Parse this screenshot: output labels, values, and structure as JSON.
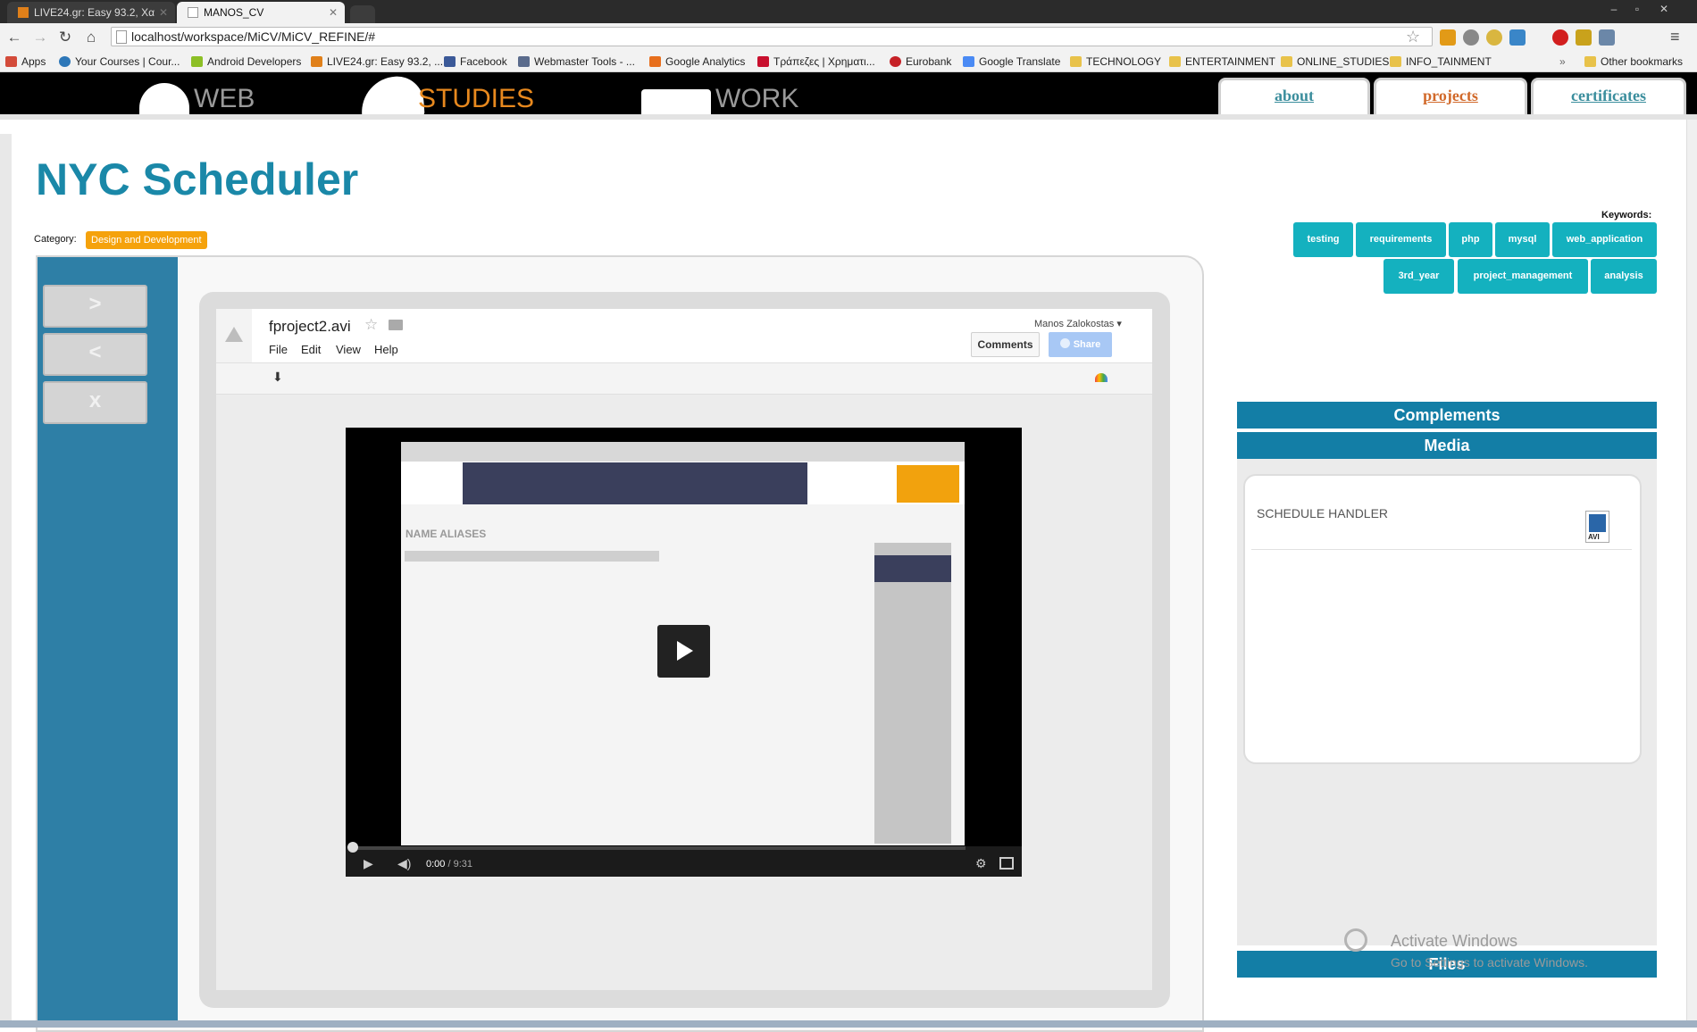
{
  "browser": {
    "tabs": [
      {
        "title": "LIVE24.gr: Easy 93.2, Χα",
        "active": false
      },
      {
        "title": "MANOS_CV",
        "active": true
      }
    ],
    "url": "localhost/workspace/MiCV/MiCV_REFINE/#",
    "bookmarks": [
      "Apps",
      "Your Courses | Cour...",
      "Android Developers",
      "LIVE24.gr: Easy 93.2, ...",
      "Facebook",
      "Webmaster Tools - ...",
      "Google Analytics",
      "Τράπεζες | Χρηματι...",
      "Eurobank",
      "Google Translate",
      "TECHNOLOGY",
      "ENTERTAINMENT",
      "ONLINE_STUDIES",
      "INFO_TAINMENT"
    ],
    "other_bookmarks": "Other bookmarks",
    "overflow": "»",
    "window_controls": [
      "–",
      "▫",
      "✕"
    ]
  },
  "site": {
    "nav": [
      {
        "label": "WEB",
        "active": false
      },
      {
        "label": "STUDIES",
        "active": true
      },
      {
        "label": "WORK",
        "active": false
      }
    ],
    "tabs": [
      {
        "label": "about",
        "active": false
      },
      {
        "label": "projects",
        "active": true
      },
      {
        "label": "certificates",
        "active": false
      }
    ]
  },
  "project": {
    "title": "NYC Scheduler",
    "category_label": "Category:",
    "category": "Design and Development",
    "side_buttons": [
      ">",
      "<",
      "x"
    ],
    "keywords_label": "Keywords:",
    "keywords": [
      "testing",
      "requirements",
      "php",
      "mysql",
      "web_application",
      "3rd_year",
      "project_management",
      "analysis"
    ]
  },
  "drive_viewer": {
    "filename": "fproject2.avi",
    "menu": [
      "File",
      "Edit",
      "View",
      "Help"
    ],
    "owner": "Manos Zalokostas ▾",
    "comments_btn": "Comments",
    "share_btn": "Share",
    "video": {
      "current_time": "0:00",
      "duration": "/ 9:31",
      "progress": 0,
      "embedded_heading": "NAME ALIASES"
    }
  },
  "right_panel": {
    "complements": "Complements",
    "media": "Media",
    "media_items": [
      {
        "name": "SCHEDULE HANDLER",
        "type": "AVI"
      }
    ],
    "files": "Files"
  },
  "watermark": {
    "line1": "Activate Windows",
    "line2": "Go to Settings to activate Windows."
  },
  "colors": {
    "accent_blue": "#1a88a8",
    "header_bar": "#137ea6",
    "keyword": "#14b1bf",
    "category": "#f5a20c",
    "sidebar": "#2e7fa6"
  }
}
